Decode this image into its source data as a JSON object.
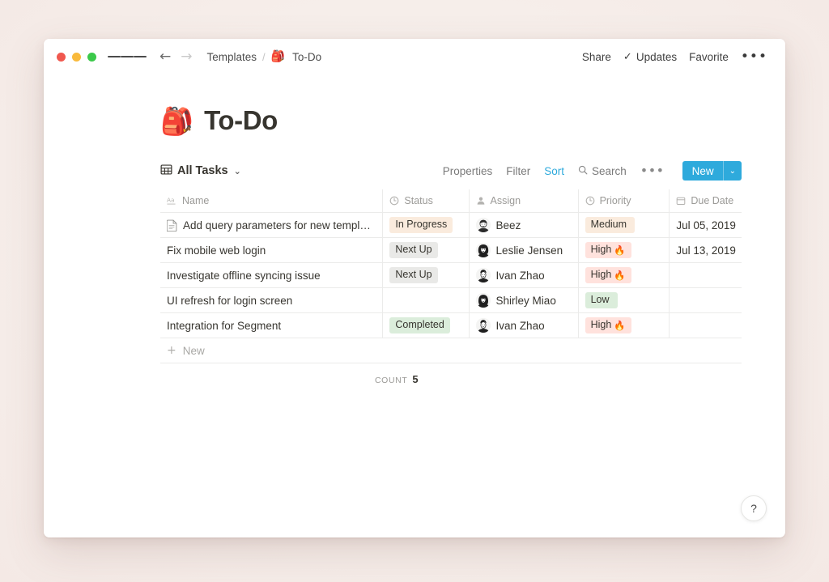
{
  "window": {
    "traffic_lights": [
      "close",
      "minimize",
      "maximize"
    ],
    "menu_icon": "hamburger-icon",
    "back_arrow": "←",
    "forward_arrow": "→",
    "breadcrumb": {
      "parent": "Templates",
      "separator": "/",
      "current_emoji": "🎒",
      "current": "To-Do"
    },
    "actions": {
      "share": "Share",
      "updates_check": "✓",
      "updates": "Updates",
      "favorite": "Favorite",
      "more": "•••"
    }
  },
  "page": {
    "emoji": "🎒",
    "title": "To-Do"
  },
  "toolbar": {
    "view_icon": "table-icon",
    "view_name": "All Tasks",
    "view_chevron": "⌄",
    "properties": "Properties",
    "filter": "Filter",
    "sort": "Sort",
    "search_icon": "search-icon",
    "search": "Search",
    "more": "•••",
    "new_label": "New",
    "new_chevron": "⌄",
    "accent_color": "#2eaadc",
    "sort_active_color": "#2eaadc"
  },
  "table": {
    "columns": [
      {
        "key": "name",
        "label": "Name",
        "icon": "text-aa-icon"
      },
      {
        "key": "status",
        "label": "Status",
        "icon": "select-circle-icon"
      },
      {
        "key": "assign",
        "label": "Assign",
        "icon": "person-icon"
      },
      {
        "key": "priority",
        "label": "Priority",
        "icon": "select-circle-icon"
      },
      {
        "key": "due",
        "label": "Due Date",
        "icon": "calendar-icon"
      }
    ],
    "rows": [
      {
        "name": "Add query parameters for new templates",
        "has_doc_icon": true,
        "status": "In Progress",
        "status_style": "inprogress",
        "assign": "Beez",
        "avatar": "beez",
        "priority": "Medium",
        "priority_emoji": "",
        "priority_style": "medium",
        "due": "Jul 05, 2019"
      },
      {
        "name": "Fix mobile web login",
        "has_doc_icon": false,
        "status": "Next Up",
        "status_style": "nextup",
        "assign": "Leslie Jensen",
        "avatar": "leslie",
        "priority": "High",
        "priority_emoji": "🔥",
        "priority_style": "high",
        "due": "Jul 13, 2019"
      },
      {
        "name": "Investigate offline syncing issue",
        "has_doc_icon": false,
        "status": "Next Up",
        "status_style": "nextup",
        "assign": "Ivan Zhao",
        "avatar": "ivan",
        "priority": "High",
        "priority_emoji": "🔥",
        "priority_style": "high",
        "due": ""
      },
      {
        "name": "UI refresh for login screen",
        "has_doc_icon": false,
        "status": "",
        "status_style": "none",
        "assign": "Shirley Miao",
        "avatar": "shirley",
        "priority": "Low",
        "priority_emoji": "",
        "priority_style": "low",
        "due": ""
      },
      {
        "name": "Integration for Segment",
        "has_doc_icon": false,
        "status": "Completed",
        "status_style": "completed",
        "assign": "Ivan Zhao",
        "avatar": "ivan",
        "priority": "High",
        "priority_emoji": "🔥",
        "priority_style": "high",
        "due": ""
      }
    ],
    "new_row_plus": "+",
    "new_row_label": "New",
    "count_label": "COUNT",
    "count_value": "5"
  },
  "help": {
    "glyph": "?"
  },
  "colors": {
    "badge_inprogress_bg": "#faebdd",
    "badge_nextup_bg": "#e9e9e7",
    "badge_completed_bg": "#dbeddb",
    "badge_high_bg": "#ffe2dd",
    "badge_low_bg": "#dbeddb",
    "badge_medium_bg": "#faebdd",
    "text_primary": "#37352f",
    "text_muted": "#9b9a97",
    "window_bg": "#ffffff",
    "backdrop": "#f6efec"
  }
}
